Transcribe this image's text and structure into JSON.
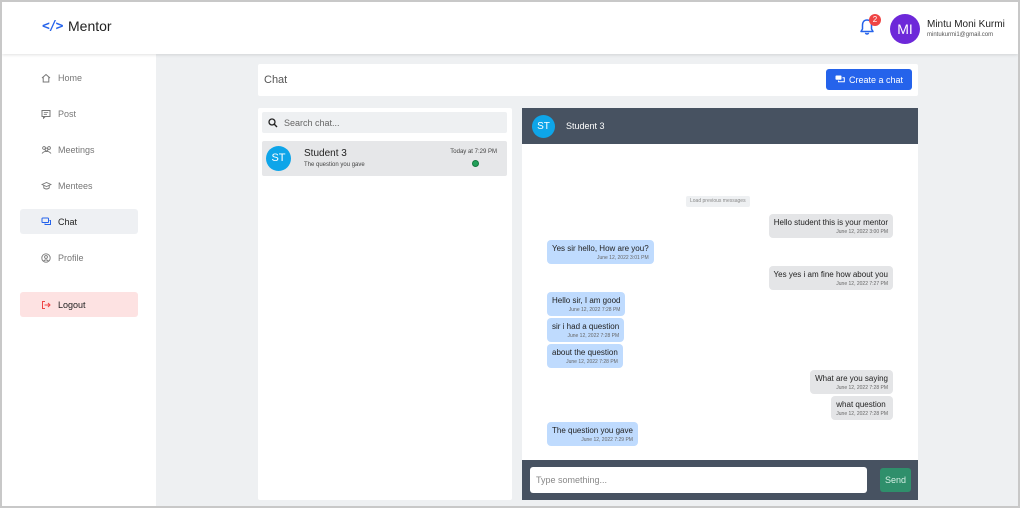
{
  "brand": {
    "icon": "</>",
    "name": "Mentor"
  },
  "header": {
    "notification_count": "2",
    "user_initials": "MI",
    "user_name": "Mintu Moni Kurmi",
    "user_email": "mintukurmi1@gmail.com"
  },
  "sidebar": {
    "items": [
      {
        "label": "Home",
        "icon": "home-icon"
      },
      {
        "label": "Post",
        "icon": "post-icon"
      },
      {
        "label": "Meetings",
        "icon": "meetings-icon"
      },
      {
        "label": "Mentees",
        "icon": "mentees-icon"
      },
      {
        "label": "Chat",
        "icon": "chat-icon",
        "active": true
      },
      {
        "label": "Profile",
        "icon": "profile-icon"
      }
    ],
    "logout_label": "Logout"
  },
  "page": {
    "title": "Chat",
    "create_button_label": "Create a chat"
  },
  "chat_list": {
    "search_placeholder": "Search chat...",
    "items": [
      {
        "initials": "ST",
        "name": "Student 3",
        "preview": "The question you gave",
        "time": "Today at 7:29 PM",
        "online": true
      }
    ]
  },
  "conversation": {
    "initials": "ST",
    "name": "Student 3",
    "load_previous_label": "Load previous messages",
    "messages": [
      {
        "text": "Hello student this is your mentor",
        "time": "June 12, 2022 3:00 PM",
        "direction": "received"
      },
      {
        "text": "Yes sir hello, How are you?",
        "time": "June 12, 2022 3:01 PM",
        "direction": "sent"
      },
      {
        "text": "Yes yes i am fine how about you",
        "time": "June 12, 2022 7:27 PM",
        "direction": "received"
      },
      {
        "text": "Hello sir, I am good",
        "time": "June 12, 2022 7:28 PM",
        "direction": "sent"
      },
      {
        "text": "sir i had a question",
        "time": "June 12, 2022 7:28 PM",
        "direction": "sent"
      },
      {
        "text": "about the question",
        "time": "June 12, 2022 7:28 PM",
        "direction": "sent"
      },
      {
        "text": "What are you saying",
        "time": "June 12, 2022 7:28 PM",
        "direction": "received"
      },
      {
        "text": "what question",
        "time": "June 12, 2022 7:28 PM",
        "direction": "received"
      },
      {
        "text": "The question you gave",
        "time": "June 12, 2022 7:29 PM",
        "direction": "sent"
      }
    ],
    "composer_placeholder": "Type something...",
    "send_label": "Send"
  },
  "colors": {
    "accent": "#2563eb",
    "avatar_user": "#6d28d9",
    "avatar_student": "#0ea5e9",
    "conversation_bar": "#475261",
    "sent_bubble": "#bfdbfe",
    "received_bubble": "#e4e5e7",
    "send_button": "#2f8f6b",
    "online": "#22a05a",
    "badge": "#ef4444",
    "logout_bg": "#fde2e2"
  }
}
